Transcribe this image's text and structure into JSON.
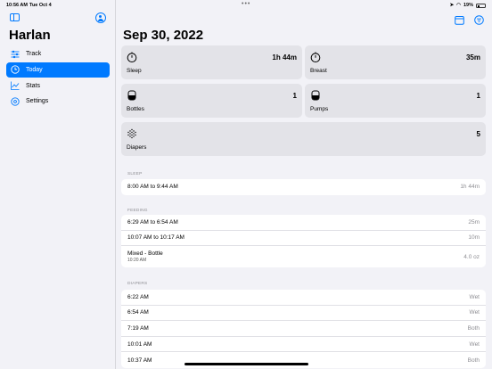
{
  "status_bar": {
    "time": "10:56 AM",
    "date": "Tue Oct 4",
    "dots": "•••",
    "battery": "19%"
  },
  "sidebar": {
    "title": "Harlan",
    "items": [
      {
        "label": "Track",
        "icon": "sliders-icon",
        "active": false
      },
      {
        "label": "Today",
        "icon": "clock-icon",
        "active": true
      },
      {
        "label": "Stats",
        "icon": "chart-line-icon",
        "active": false
      },
      {
        "label": "Settings",
        "icon": "gear-icon",
        "active": false
      }
    ]
  },
  "main": {
    "title": "Sep 30, 2022",
    "cards": [
      {
        "label": "Sleep",
        "value": "1h 44m",
        "icon": "timer-icon"
      },
      {
        "label": "Breast",
        "value": "35m",
        "icon": "timer-icon"
      },
      {
        "label": "Bottles",
        "value": "1",
        "icon": "bottle-icon"
      },
      {
        "label": "Pumps",
        "value": "1",
        "icon": "bottle-icon"
      },
      {
        "label": "Diapers",
        "value": "5",
        "icon": "diaper-dots-icon"
      }
    ],
    "sleep": {
      "header": "SLEEP",
      "rows": [
        {
          "text": "8:00 AM  to  9:44 AM",
          "right": "1h 44m"
        }
      ]
    },
    "feeding": {
      "header": "FEEDING",
      "rows": [
        {
          "text": "6:29 AM  to  6:54 AM",
          "right": "25m",
          "sub": ""
        },
        {
          "text": "10:07 AM  to  10:17 AM",
          "right": "10m",
          "sub": ""
        },
        {
          "text": "Mixed  -  Bottle",
          "right": "4.0 oz",
          "sub": "10:20 AM"
        }
      ]
    },
    "diapers": {
      "header": "DIAPERS",
      "rows": [
        {
          "text": "6:22 AM",
          "right": "Wet"
        },
        {
          "text": "6:54 AM",
          "right": "Wet"
        },
        {
          "text": "7:19 AM",
          "right": "Both"
        },
        {
          "text": "10:01 AM",
          "right": "Wet"
        },
        {
          "text": "10:37 AM",
          "right": "Both"
        }
      ]
    }
  },
  "colors": {
    "accent": "#007aff",
    "card_bg": "#e3e3e8",
    "page_bg": "#f2f2f7"
  }
}
